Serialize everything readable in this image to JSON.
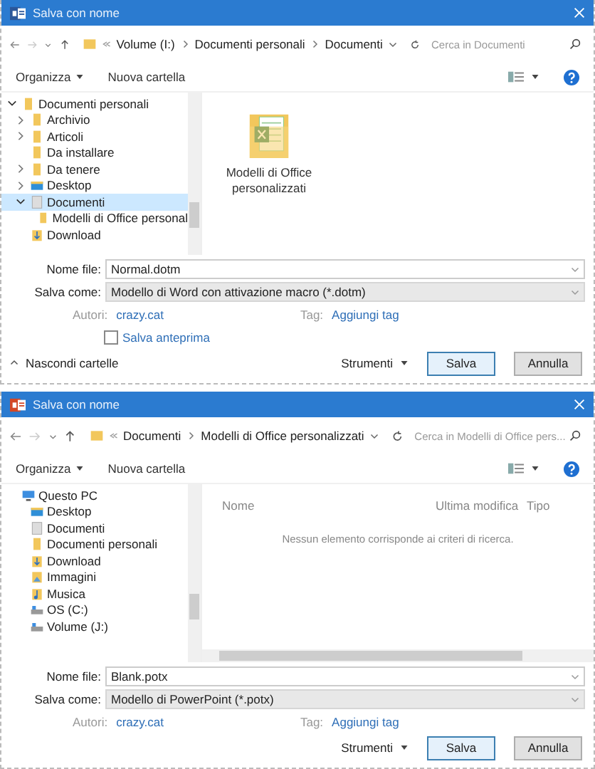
{
  "dialogs": [
    {
      "kind": "word",
      "title": "Salva con nome",
      "path": [
        "Volume (I:)",
        "Documenti personali",
        "Documenti"
      ],
      "search": {
        "placeholder": "Cerca in Documenti"
      },
      "toolbar": {
        "organize": "Organizza",
        "new_folder": "Nuova cartella"
      },
      "nav": [
        {
          "label": "Documenti personali",
          "kind": "folder",
          "expanded": true,
          "selected": false,
          "children": [
            {
              "label": "Archivio",
              "kind": "folder",
              "expanded": false,
              "selected": false
            },
            {
              "label": "Articoli",
              "kind": "folder",
              "expanded": false,
              "selected": false
            },
            {
              "label": "Da installare",
              "kind": "folder",
              "selected": false
            },
            {
              "label": "Da tenere",
              "kind": "folder",
              "expanded": false,
              "selected": false
            },
            {
              "label": "Desktop",
              "kind": "desktop",
              "expanded": false,
              "selected": false
            },
            {
              "label": "Documenti",
              "kind": "documents",
              "expanded": true,
              "selected": true,
              "children": [
                {
                  "label": "Modelli di Office personal",
                  "kind": "folder",
                  "selected": false
                }
              ]
            },
            {
              "label": "Download",
              "kind": "download",
              "selected": false
            }
          ]
        }
      ],
      "content": {
        "kind": "icons",
        "items": [
          {
            "name": "Modelli di Office personalizzati",
            "kind": "excel-folder"
          }
        ]
      },
      "form": {
        "file_name_label": "Nome file:",
        "file_name": "Normal.dotm",
        "save_as_label": "Salva come:",
        "save_as": "Modello di Word con attivazione macro (*.dotm)",
        "authors_label": "Autori:",
        "authors": "crazy.cat",
        "tags_label": "Tag:",
        "tags": "Aggiungi tag"
      },
      "thumbnail": {
        "label": "Salva anteprima",
        "checked": false
      },
      "hide_folders": "Nascondi cartelle",
      "footer": {
        "tools": "Strumenti",
        "buttons": [
          {
            "label": "Salva",
            "default": true
          },
          {
            "label": "Annulla",
            "default": false
          }
        ]
      }
    },
    {
      "kind": "powerpoint",
      "title": "Salva con nome",
      "path": [
        "Documenti",
        "Modelli di Office personalizzati"
      ],
      "search": {
        "placeholder": "Cerca in Modelli di Office pers..."
      },
      "toolbar": {
        "organize": "Organizza",
        "new_folder": "Nuova cartella"
      },
      "nav": [
        {
          "label": "Questo PC",
          "kind": "pc",
          "selected": false,
          "children": [
            {
              "label": "Desktop",
              "kind": "desktop",
              "selected": false
            },
            {
              "label": "Documenti",
              "kind": "documents",
              "selected": false
            },
            {
              "label": "Documenti personali",
              "kind": "folder",
              "selected": false
            },
            {
              "label": "Download",
              "kind": "download",
              "selected": false
            },
            {
              "label": "Immagini",
              "kind": "images",
              "selected": false
            },
            {
              "label": "Musica",
              "kind": "music",
              "selected": false
            },
            {
              "label": "OS (C:)",
              "kind": "drive",
              "selected": false
            },
            {
              "label": "Volume (J:)",
              "kind": "drive",
              "selected": false
            }
          ]
        }
      ],
      "content": {
        "kind": "details",
        "columns": [
          "Nome",
          "Ultima modifica",
          "Tipo"
        ],
        "empty": "Nessun elemento corrisponde ai criteri di ricerca."
      },
      "form": {
        "file_name_label": "Nome file:",
        "file_name": "Blank.potx",
        "save_as_label": "Salva come:",
        "save_as": "Modello di PowerPoint (*.potx)",
        "authors_label": "Autori:",
        "authors": "crazy.cat",
        "tags_label": "Tag:",
        "tags": "Aggiungi tag"
      },
      "footer": {
        "tools": "Strumenti",
        "buttons": [
          {
            "label": "Salva",
            "default": true
          },
          {
            "label": "Annulla",
            "default": false
          }
        ]
      }
    }
  ]
}
